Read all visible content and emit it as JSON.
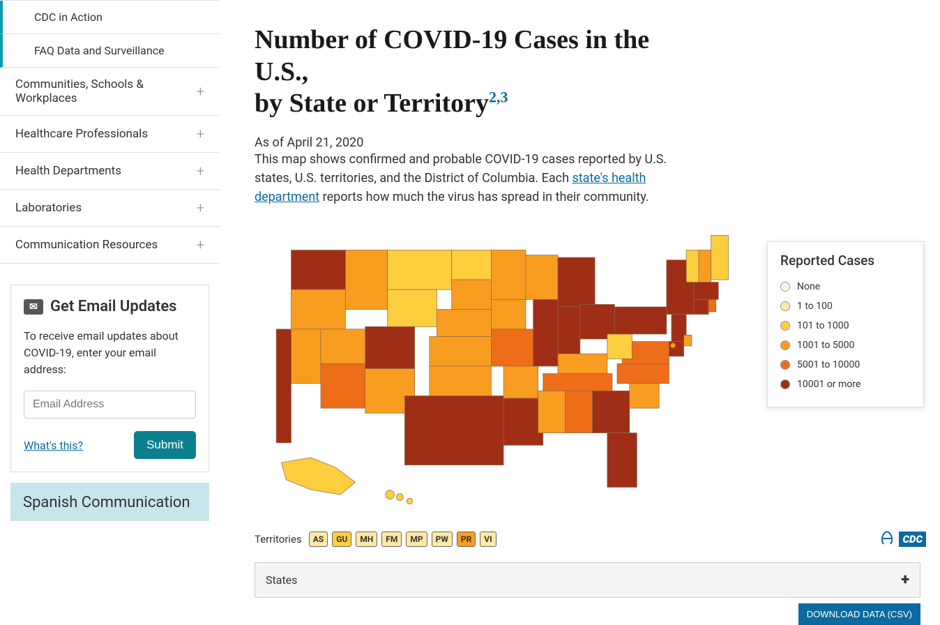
{
  "sidebar": {
    "nav": [
      {
        "label": "CDC in Action",
        "sub": true
      },
      {
        "label": "FAQ Data and Surveillance",
        "sub": true
      },
      {
        "label": "Communities, Schools & Workplaces",
        "expandable": true
      },
      {
        "label": "Healthcare Professionals",
        "expandable": true
      },
      {
        "label": "Health Departments",
        "expandable": true
      },
      {
        "label": "Laboratories",
        "expandable": true
      },
      {
        "label": "Communication Resources",
        "expandable": true
      }
    ],
    "widget": {
      "title": "Get Email Updates",
      "desc": "To receive email updates about COVID-19, enter your email address:",
      "placeholder": "Email Address",
      "whats_this": "What's this?",
      "submit": "Submit"
    },
    "spanish": "Spanish Communication"
  },
  "main": {
    "title_line1": "Number of COVID-19 Cases in the U.S.,",
    "title_line2": "by State or Territory",
    "title_sup": "2,3",
    "as_of": "As of April 21, 2020",
    "desc_a": "This map shows confirmed and probable COVID-19 cases reported by U.S. states, U.S. territories, and the District of Columbia. Each ",
    "desc_link": "state's health department",
    "desc_b": " reports how much the virus has spread in their community."
  },
  "legend": {
    "title": "Reported Cases",
    "items": [
      {
        "label": "None",
        "color": "#f5fae7"
      },
      {
        "label": "1 to 100",
        "color": "#fde9a6"
      },
      {
        "label": "101 to 1000",
        "color": "#fdce3e"
      },
      {
        "label": "1001 to 5000",
        "color": "#f99d21"
      },
      {
        "label": "5001 to 10000",
        "color": "#ee6d19"
      },
      {
        "label": "10001 or more",
        "color": "#a02e16"
      }
    ]
  },
  "territories": {
    "label": "Territories",
    "items": [
      {
        "code": "AS",
        "color": "#fde9a6"
      },
      {
        "code": "GU",
        "color": "#fdce3e"
      },
      {
        "code": "MH",
        "color": "#fde9a6"
      },
      {
        "code": "FM",
        "color": "#fde9a6"
      },
      {
        "code": "MP",
        "color": "#fde9a6"
      },
      {
        "code": "PW",
        "color": "#fde9a6"
      },
      {
        "code": "PR",
        "color": "#f99d21"
      },
      {
        "code": "VI",
        "color": "#fde9a6"
      }
    ]
  },
  "states_bar": "States",
  "download": "DOWNLOAD DATA (CSV)",
  "chart_data": {
    "type": "map",
    "title": "Number of COVID-19 Cases in the U.S., by State or Territory",
    "as_of": "April 21, 2020",
    "metric": "Reported Cases",
    "bins": [
      "None",
      "1 to 100",
      "101 to 1000",
      "1001 to 5000",
      "5001 to 10000",
      "10001 or more"
    ],
    "colors": {
      "None": "#f5fae7",
      "1 to 100": "#fde9a6",
      "101 to 1000": "#fdce3e",
      "1001 to 5000": "#f99d21",
      "5001 to 10000": "#ee6d19",
      "10001 or more": "#a02e16"
    },
    "states": {
      "WA": "10001 or more",
      "OR": "1001 to 5000",
      "CA": "10001 or more",
      "NV": "1001 to 5000",
      "ID": "1001 to 5000",
      "MT": "101 to 1000",
      "WY": "101 to 1000",
      "UT": "1001 to 5000",
      "AZ": "5001 to 10000",
      "NM": "1001 to 5000",
      "CO": "10001 or more",
      "ND": "101 to 1000",
      "SD": "1001 to 5000",
      "NE": "1001 to 5000",
      "KS": "1001 to 5000",
      "OK": "1001 to 5000",
      "TX": "10001 or more",
      "MN": "1001 to 5000",
      "IA": "1001 to 5000",
      "MO": "5001 to 10000",
      "AR": "1001 to 5000",
      "LA": "10001 or more",
      "WI": "1001 to 5000",
      "IL": "10001 or more",
      "MI": "10001 or more",
      "IN": "10001 or more",
      "OH": "10001 or more",
      "KY": "1001 to 5000",
      "TN": "5001 to 10000",
      "MS": "1001 to 5000",
      "AL": "5001 to 10000",
      "GA": "10001 or more",
      "FL": "10001 or more",
      "SC": "1001 to 5000",
      "NC": "5001 to 10000",
      "VA": "5001 to 10000",
      "WV": "101 to 1000",
      "MD": "10001 or more",
      "DE": "1001 to 5000",
      "PA": "10001 or more",
      "NJ": "10001 or more",
      "NY": "10001 or more",
      "CT": "10001 or more",
      "RI": "5001 to 10000",
      "MA": "10001 or more",
      "VT": "101 to 1000",
      "NH": "1001 to 5000",
      "ME": "101 to 1000",
      "AK": "101 to 1000",
      "HI": "101 to 1000",
      "DC": "1001 to 5000"
    },
    "territories": {
      "AS": "1 to 100",
      "GU": "101 to 1000",
      "MH": "1 to 100",
      "FM": "1 to 100",
      "MP": "1 to 100",
      "PW": "1 to 100",
      "PR": "1001 to 5000",
      "VI": "1 to 100"
    }
  }
}
